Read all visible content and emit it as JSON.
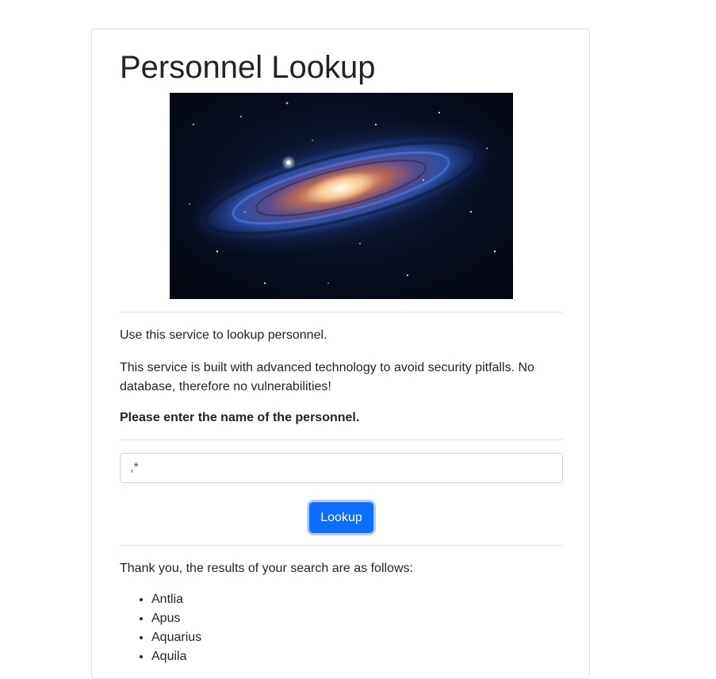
{
  "page": {
    "title": "Personnel Lookup",
    "image_alt": "Galaxy image"
  },
  "intro": {
    "line1": "Use this service to lookup personnel.",
    "line2": "This service is built with advanced technology to avoid security pitfalls. No database, therefore no vulnerabilities!",
    "prompt": "Please enter the name of the personnel."
  },
  "search": {
    "value": ",*",
    "button_label": "Lookup"
  },
  "results": {
    "heading": "Thank you, the results of your search are as follows:",
    "items": [
      "Antlia",
      "Apus",
      "Aquarius",
      "Aquila"
    ]
  },
  "colors": {
    "button": "#0d6efd",
    "text": "#212529",
    "border": "#dee2e6"
  }
}
